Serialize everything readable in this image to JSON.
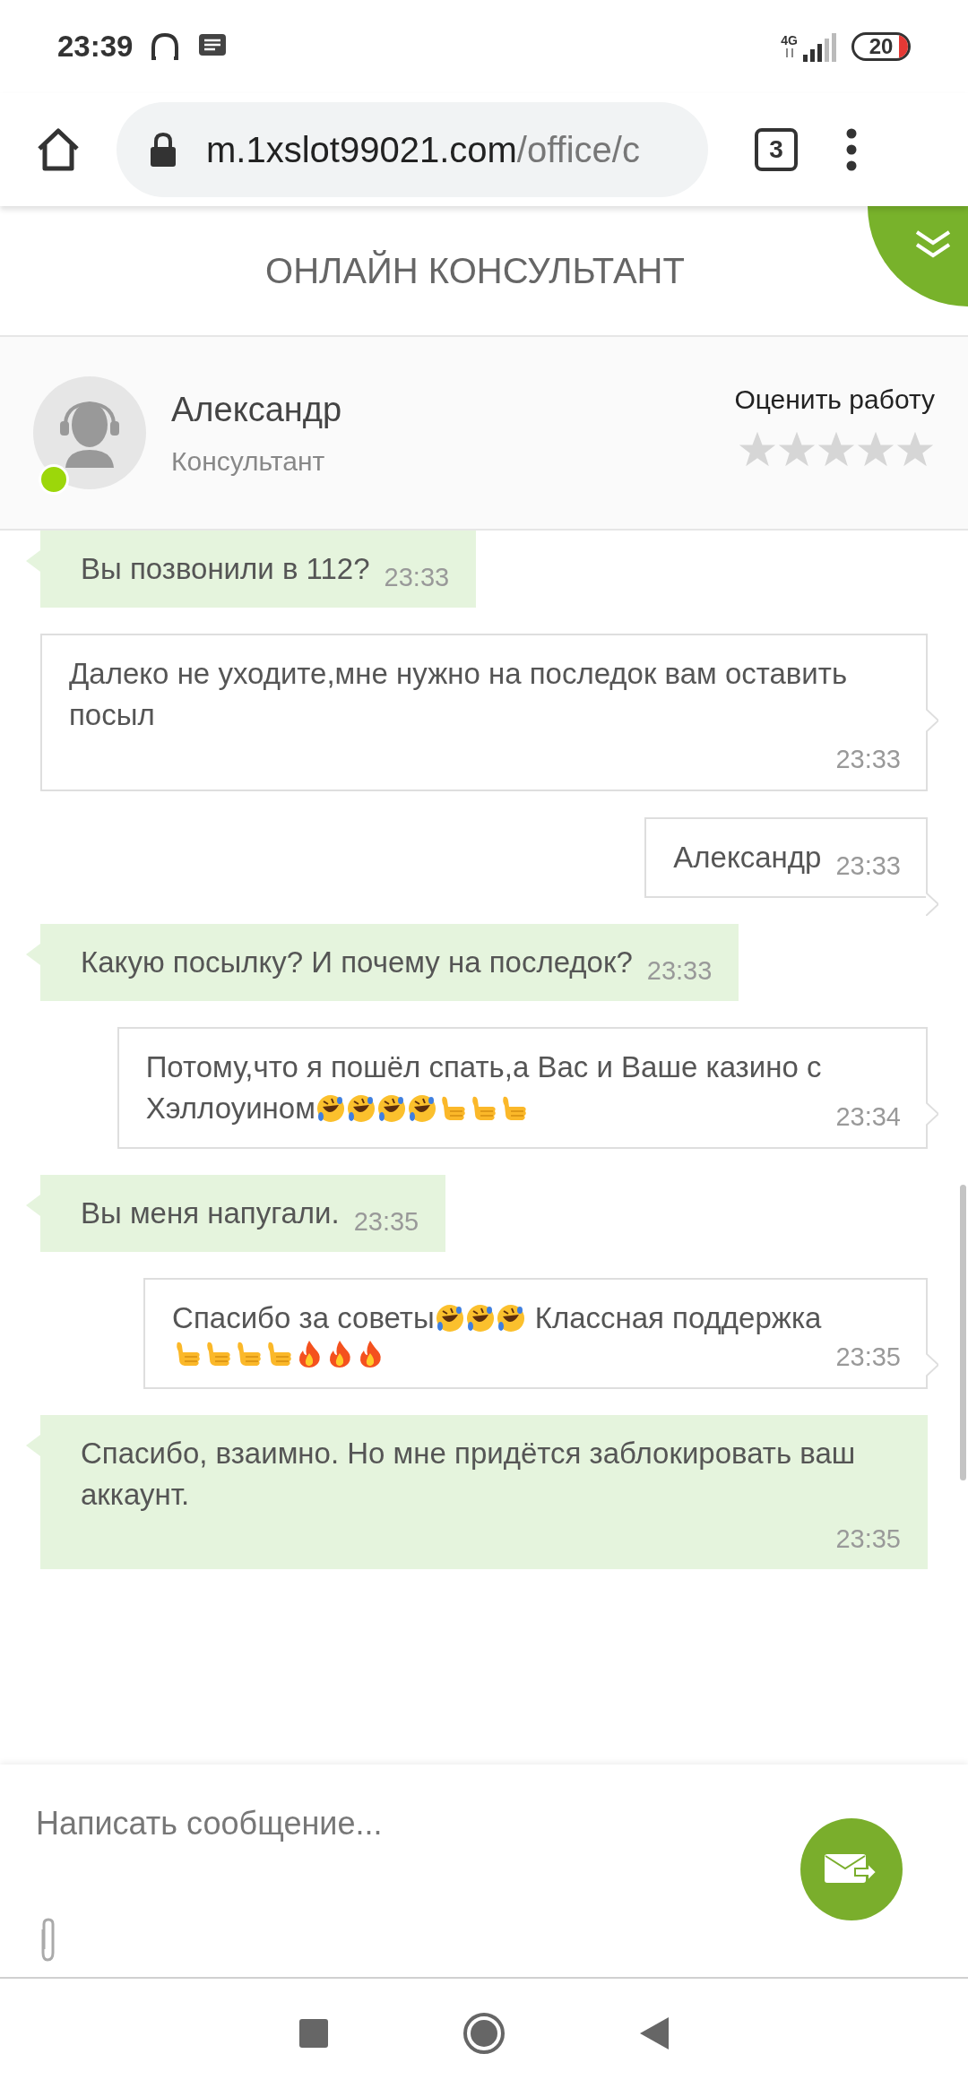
{
  "status_bar": {
    "time": "23:39",
    "network": "4G",
    "battery": "20"
  },
  "browser": {
    "url_host": "m.1xslot99021.com",
    "url_path": "/office/c",
    "tab_count": "3"
  },
  "chat_header": {
    "title": "ОНЛАЙН КОНСУЛЬТАНТ"
  },
  "consultant": {
    "name": "Александр",
    "role": "Консультант",
    "online": true,
    "rating": {
      "label": "Оценить работу",
      "stars": 0
    }
  },
  "messages": [
    {
      "kind": "operator",
      "lines": [
        [
          {
            "kind": "text",
            "text": "Вы позвонили в 112?"
          }
        ]
      ],
      "time": "23:33"
    },
    {
      "kind": "user",
      "lines": [
        [
          {
            "kind": "text",
            "text": "Далеко не уходите,мне нужно на последок вам оставить посыл"
          }
        ]
      ],
      "time": "23:33"
    },
    {
      "kind": "user",
      "lines": [
        [
          {
            "kind": "text",
            "text": "Александр"
          }
        ]
      ],
      "time": "23:33"
    },
    {
      "kind": "operator",
      "lines": [
        [
          {
            "kind": "text",
            "text": "Какую посылку? И почему на последок?"
          }
        ]
      ],
      "time": "23:33"
    },
    {
      "kind": "user",
      "lines": [
        [
          {
            "kind": "text",
            "text": "Потому,что я пошёл спать,а Вас и Ваше казино с"
          }
        ],
        [
          {
            "kind": "text",
            "text": "Хэллоуином"
          },
          {
            "kind": "laugh"
          },
          {
            "kind": "laugh"
          },
          {
            "kind": "laugh"
          },
          {
            "kind": "laugh"
          },
          {
            "kind": "thumb"
          },
          {
            "kind": "thumb"
          },
          {
            "kind": "thumb"
          }
        ]
      ],
      "time": "23:34"
    },
    {
      "kind": "operator",
      "lines": [
        [
          {
            "kind": "text",
            "text": "Вы меня напугали."
          }
        ]
      ],
      "time": "23:35"
    },
    {
      "kind": "user",
      "lines": [
        [
          {
            "kind": "text",
            "text": "Спасибо за советы"
          },
          {
            "kind": "laugh"
          },
          {
            "kind": "laugh"
          },
          {
            "kind": "laugh"
          },
          {
            "kind": "text",
            "text": "Классная поддержка"
          }
        ],
        [
          {
            "kind": "thumb"
          },
          {
            "kind": "thumb"
          },
          {
            "kind": "thumb"
          },
          {
            "kind": "thumb"
          },
          {
            "kind": "fire"
          },
          {
            "kind": "fire"
          },
          {
            "kind": "fire"
          }
        ]
      ],
      "time": "23:35"
    },
    {
      "kind": "operator",
      "lines": [
        [
          {
            "kind": "text",
            "text": "Спасибо, взаимно. Но мне придётся заблокировать ваш аккаунт."
          }
        ]
      ],
      "time": "23:35"
    }
  ],
  "composer": {
    "placeholder": "Написать сообщение..."
  }
}
